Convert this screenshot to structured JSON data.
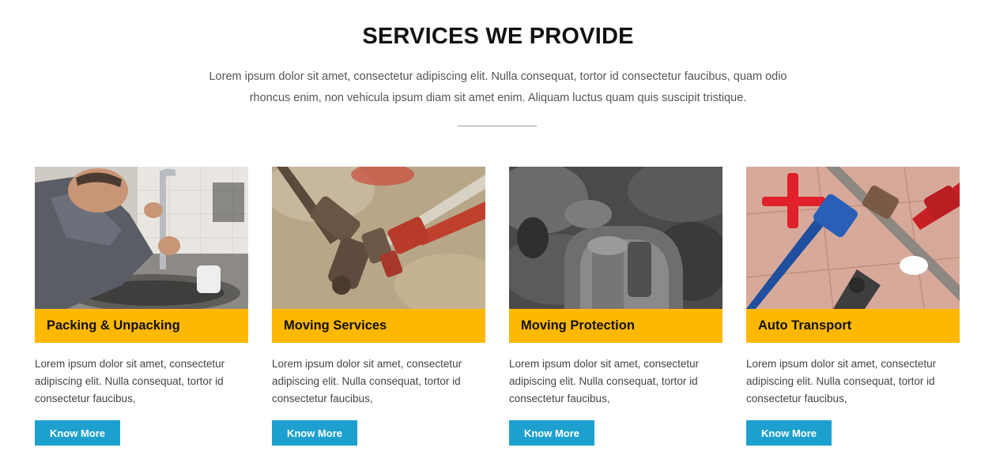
{
  "header": {
    "title": "SERVICES WE PROVIDE",
    "intro": "Lorem ipsum dolor sit amet, consectetur adipiscing elit. Nulla consequat, tortor id consectetur faucibus, quam odio rhoncus enim, non vehicula ipsum diam sit amet enim. Aliquam luctus quam quis suscipit tristique."
  },
  "colors": {
    "accent": "#ffb800",
    "button": "#1ea0cf"
  },
  "services": [
    {
      "title": "Packing & Unpacking",
      "description": "Lorem ipsum dolor sit amet, consectetur adipiscing elit. Nulla consequat, tortor id consectetur faucibus,",
      "button_label": "Know More",
      "image": "plumber-fixing-faucet-photo"
    },
    {
      "title": "Moving Services",
      "description": "Lorem ipsum dolor sit amet, consectetur adipiscing elit. Nulla consequat, tortor id consectetur faucibus,",
      "button_label": "Know More",
      "image": "pipe-wrenches-photo"
    },
    {
      "title": "Moving Protection",
      "description": "Lorem ipsum dolor sit amet, consectetur adipiscing elit. Nulla consequat, tortor id consectetur faucibus,",
      "button_label": "Know More",
      "image": "pipe-fittings-photo"
    },
    {
      "title": "Auto Transport",
      "description": "Lorem ipsum dolor sit amet, consectetur adipiscing elit. Nulla consequat, tortor id consectetur faucibus,",
      "button_label": "Know More",
      "image": "plumbing-tools-photo"
    }
  ]
}
